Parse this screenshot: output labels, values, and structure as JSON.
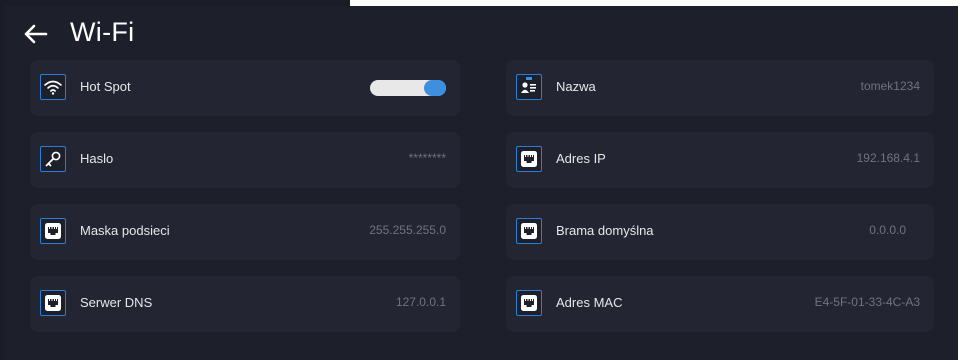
{
  "header": {
    "title": "Wi-Fi"
  },
  "left_column": [
    {
      "label": "Hot Spot",
      "icon": "wifi-icon",
      "toggle_on": true
    },
    {
      "label": "Haslo",
      "icon": "key-icon",
      "value": "********"
    },
    {
      "label": "Maska podsieci",
      "icon": "network-port-icon",
      "value": "255.255.255.0"
    },
    {
      "label": "Serwer DNS",
      "icon": "network-port-icon",
      "value": "127.0.0.1"
    }
  ],
  "right_column": [
    {
      "label": "Nazwa",
      "icon": "id-card-icon",
      "value": "tomek1234"
    },
    {
      "label": "Adres IP",
      "icon": "network-port-icon",
      "value": "192.168.4.1"
    },
    {
      "label": "Brama domyślna",
      "icon": "network-port-icon",
      "value": "0.0.0.0"
    },
    {
      "label": "Adres MAC",
      "icon": "network-port-icon",
      "value": "E4-5F-01-33-4C-A3"
    }
  ],
  "colors": {
    "background": "#1d1f2b",
    "row": "#232532",
    "accent": "#3d8fdf"
  }
}
